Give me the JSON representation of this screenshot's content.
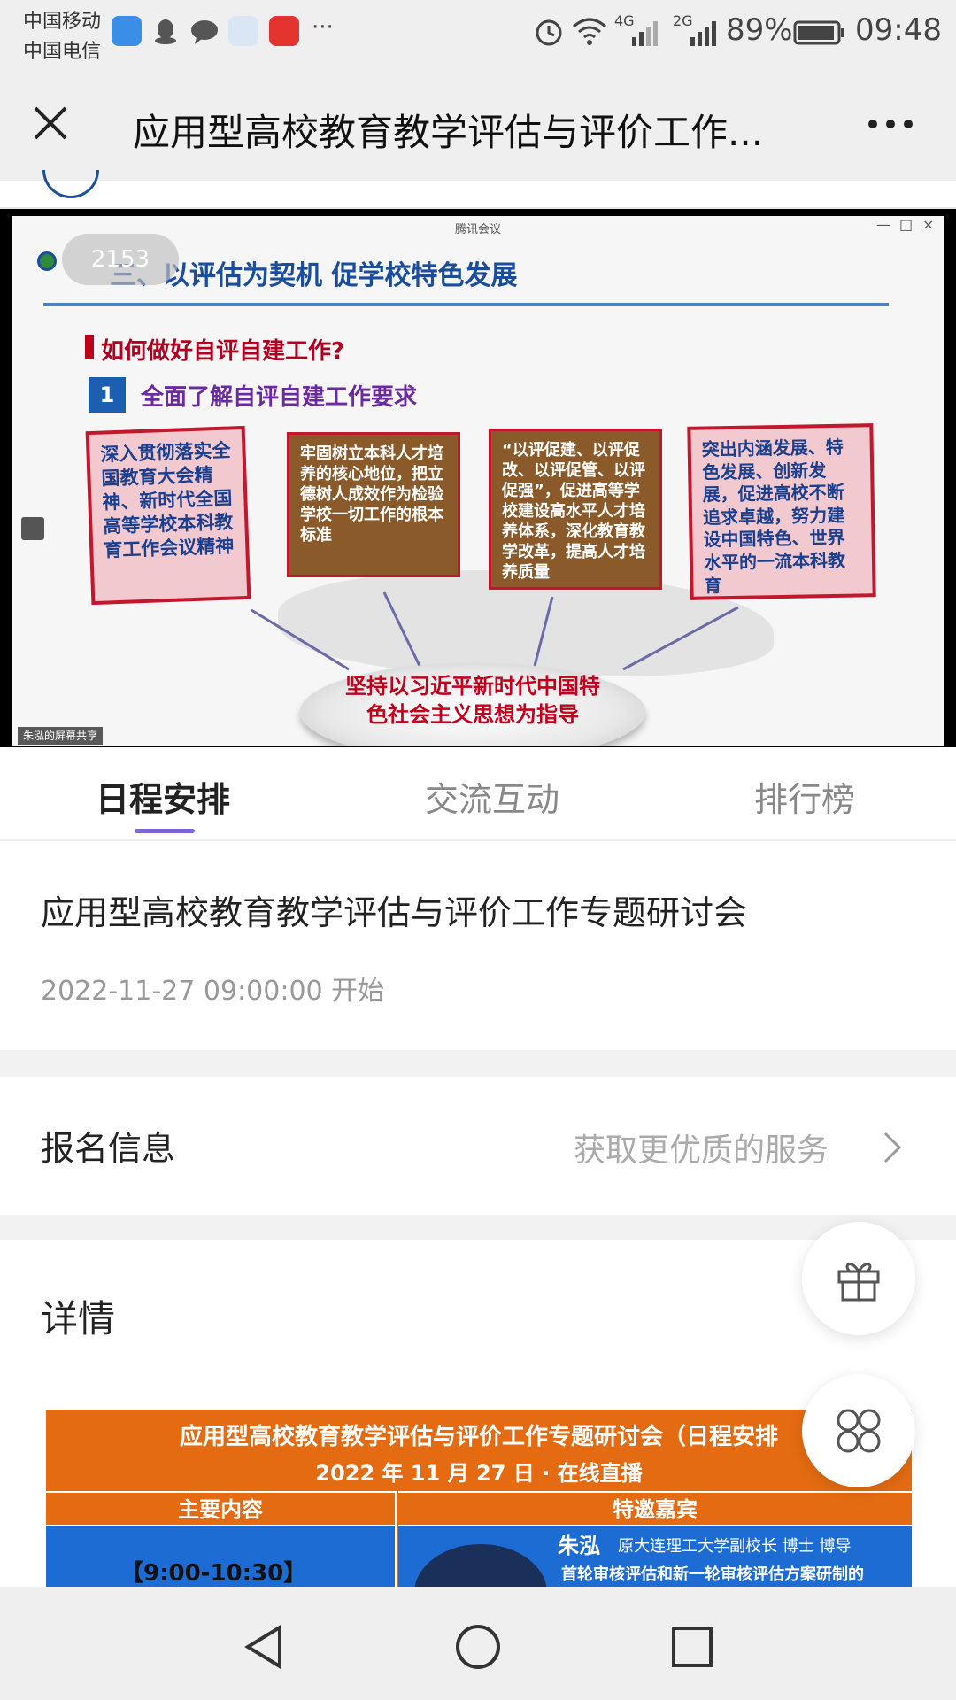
{
  "status_bar": {
    "carrier_1": "中国移动",
    "carrier_2": "中国电信",
    "more": "···",
    "net_4g": "4G",
    "net_2g": "2G",
    "battery": "89%",
    "time": "09:48"
  },
  "header": {
    "title": "应用型高校教育教学评估与评价工作..."
  },
  "video": {
    "window_title": "腾讯会议",
    "viewer_count": "2153",
    "share_label": "朱泓的屏幕共享",
    "slide": {
      "heading": "三、以评估为契机 促学校特色发展",
      "question": "如何做好自评自建工作?",
      "number": "1",
      "subtitle": "全面了解自评自建工作要求",
      "card1": "深入贯彻落实全国教育大会精神、新时代全国高等学校本科教育工作会议精神",
      "card2": "牢固树立本科人才培养的核心地位，把立德树人成效作为检验学校一切工作的根本标准",
      "card3": "“以评促建、以评促改、以评促管、以评促强”，促进高等学校建设高水平人才培养体系，深化教育教学改革，提高人才培养质量",
      "card4": "突出内涵发展、特色发展、创新发展，促进高校不断追求卓越，努力建设中国特色、世界水平的一流本科教育",
      "center_line1": "坚持以习近平新时代中国特",
      "center_line2": "色社会主义思想为指导"
    }
  },
  "tabs": [
    {
      "label": "日程安排",
      "active": true
    },
    {
      "label": "交流互动",
      "active": false
    },
    {
      "label": "排行榜",
      "active": false
    }
  ],
  "event": {
    "title": "应用型高校教育教学评估与评价工作专题研讨会",
    "start_time": "2022-11-27 09:00:00 开始"
  },
  "registration": {
    "label": "报名信息",
    "link_text": "获取更优质的服务"
  },
  "details": {
    "label": "详情",
    "poster": {
      "title": "应用型高校教育教学评估与评价工作专题研讨会（日程安排",
      "date_line": "2022 年 11 月 27 日 · 在线直播",
      "col1": "主要内容",
      "col2": "特邀嘉宾",
      "time_slot": "【9:00-10:30】",
      "guest_name": "朱泓",
      "guest_title": "原大连理工大学副校长  博士  博导",
      "guest_desc": "首轮审核评估和新一轮审核评估方案研制的"
    }
  },
  "colors": {
    "accent": "#7b63d8",
    "poster_orange": "#e46b12",
    "poster_blue": "#1c6cd3"
  }
}
